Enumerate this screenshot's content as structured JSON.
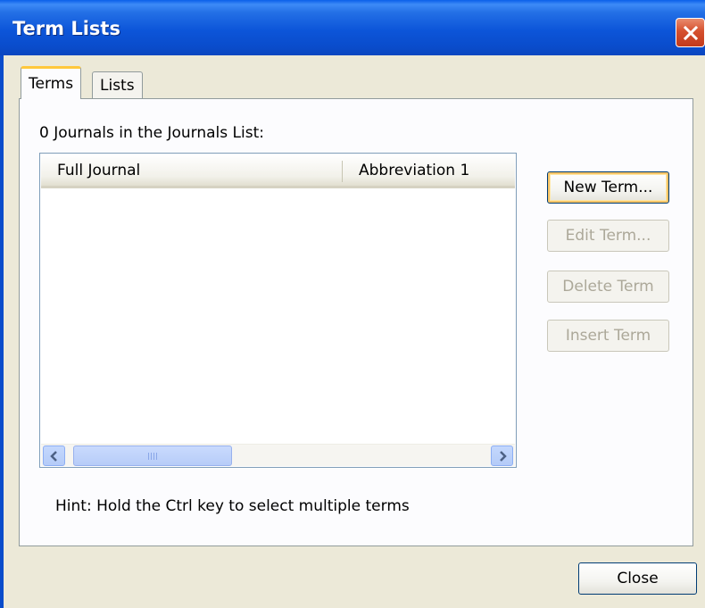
{
  "window": {
    "title": "Term Lists"
  },
  "tabs": [
    {
      "label": "Terms",
      "active": true
    },
    {
      "label": "Lists",
      "active": false
    }
  ],
  "terms_tab": {
    "count_label": "0 Journals in the Journals List:",
    "list": {
      "columns": [
        "Full Journal",
        "Abbreviation 1"
      ],
      "rows": []
    },
    "buttons": {
      "new_term": "New Term...",
      "edit_term": "Edit Term...",
      "delete_term": "Delete Term",
      "insert_term": "Insert Term"
    },
    "hint": "Hint: Hold the Ctrl key to select multiple terms"
  },
  "footer": {
    "close_label": "Close"
  },
  "colors": {
    "titlebar": "#0A4CCB",
    "close_button": "#D5502E",
    "dialog_bg": "#ECE9D8",
    "default_button_highlight": "#F6C467",
    "disabled_text": "#ACA899"
  }
}
